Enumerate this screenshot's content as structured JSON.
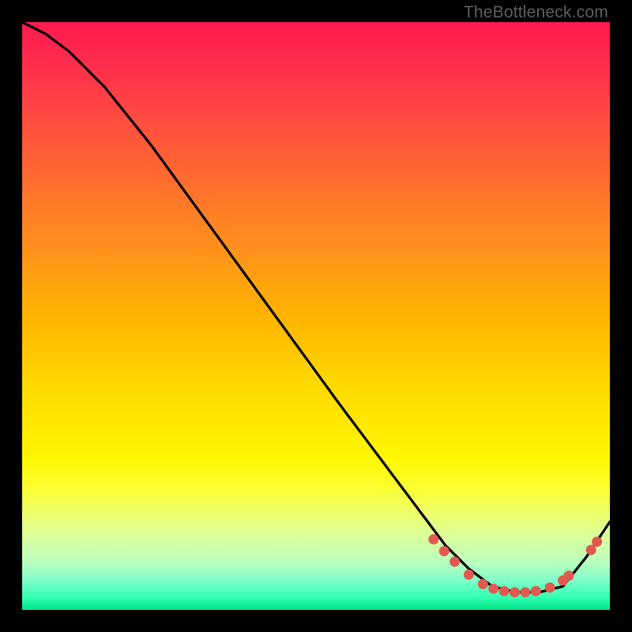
{
  "attribution": "TheBottleneck.com",
  "colors": {
    "curve": "#000000",
    "dots": "#e2594f",
    "bg_black": "#000000"
  },
  "chart_data": {
    "type": "line",
    "title": "",
    "xlabel": "",
    "ylabel": "",
    "xlim": [
      0,
      100
    ],
    "ylim": [
      0,
      100
    ],
    "curve": {
      "x": [
        0,
        4,
        8,
        14,
        22,
        30,
        38,
        46,
        54,
        60,
        66,
        72,
        76,
        80,
        84,
        88,
        92,
        96,
        100
      ],
      "y": [
        100,
        98,
        95,
        89,
        79,
        68,
        57,
        46,
        35,
        27,
        19,
        11,
        7,
        4,
        3,
        3,
        4,
        9,
        15
      ]
    },
    "series": [
      {
        "name": "dots",
        "x": [
          70.0,
          71.8,
          73.6,
          76.0,
          78.4,
          80.2,
          82.0,
          83.8,
          85.6,
          87.4,
          89.8,
          92.0,
          93.0
        ],
        "y": [
          12.0,
          10.0,
          8.2,
          6.0,
          4.4,
          3.6,
          3.2,
          3.0,
          3.0,
          3.2,
          3.8,
          5.0,
          5.8
        ]
      },
      {
        "name": "dots-right",
        "x": [
          96.8,
          97.8
        ],
        "y": [
          10.2,
          11.6
        ]
      }
    ]
  }
}
